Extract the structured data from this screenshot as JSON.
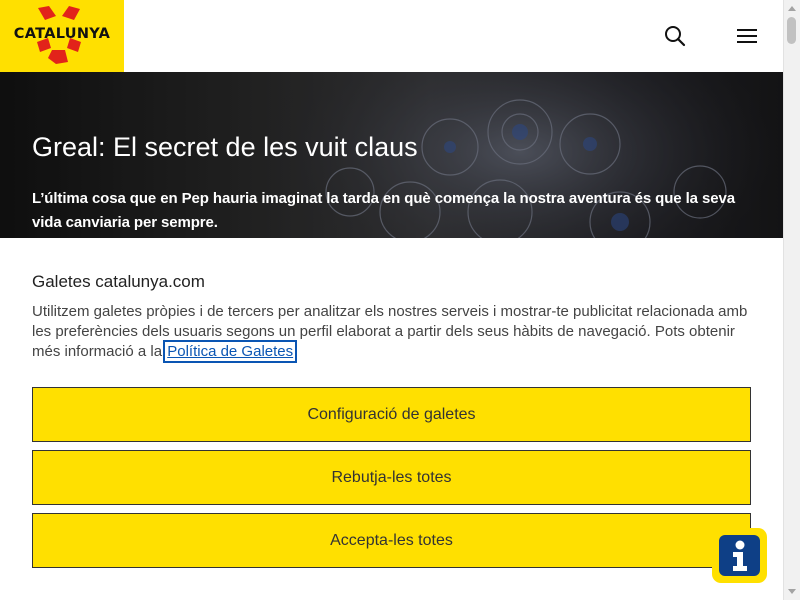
{
  "header": {
    "logo_text": "CATALUNYA",
    "brand_color": "#ffe000",
    "search_icon": "search-icon",
    "menu_icon": "hamburger-menu-icon"
  },
  "hero": {
    "title": "Greal: El secret de les vuit claus",
    "description": "L’última cosa que en Pep hauria imaginat la tarda en què comença la nostra aventura és que la seva vida canviaria per sempre."
  },
  "cookies": {
    "title": "Galetes catalunya.com",
    "description_before_link": "Utilitzem galetes pròpies i de tercers per analitzar els nostres serveis i mostrar-te publicitat relacionada amb les preferències dels usuaris segons un perfil elaborat a partir dels seus hàbits de navegació. Pots obtenir més informació  a la ",
    "policy_link": "Política de Galetes",
    "buttons": {
      "config": "Configuració de galetes",
      "reject": "Rebutja-les totes",
      "accept": "Accepta-les totes"
    },
    "button_color": "#ffe000",
    "link_color": "#0a55b3"
  },
  "info_button": {
    "icon": "info-icon",
    "label": "i",
    "icon_bg_color": "#0e3f86"
  }
}
